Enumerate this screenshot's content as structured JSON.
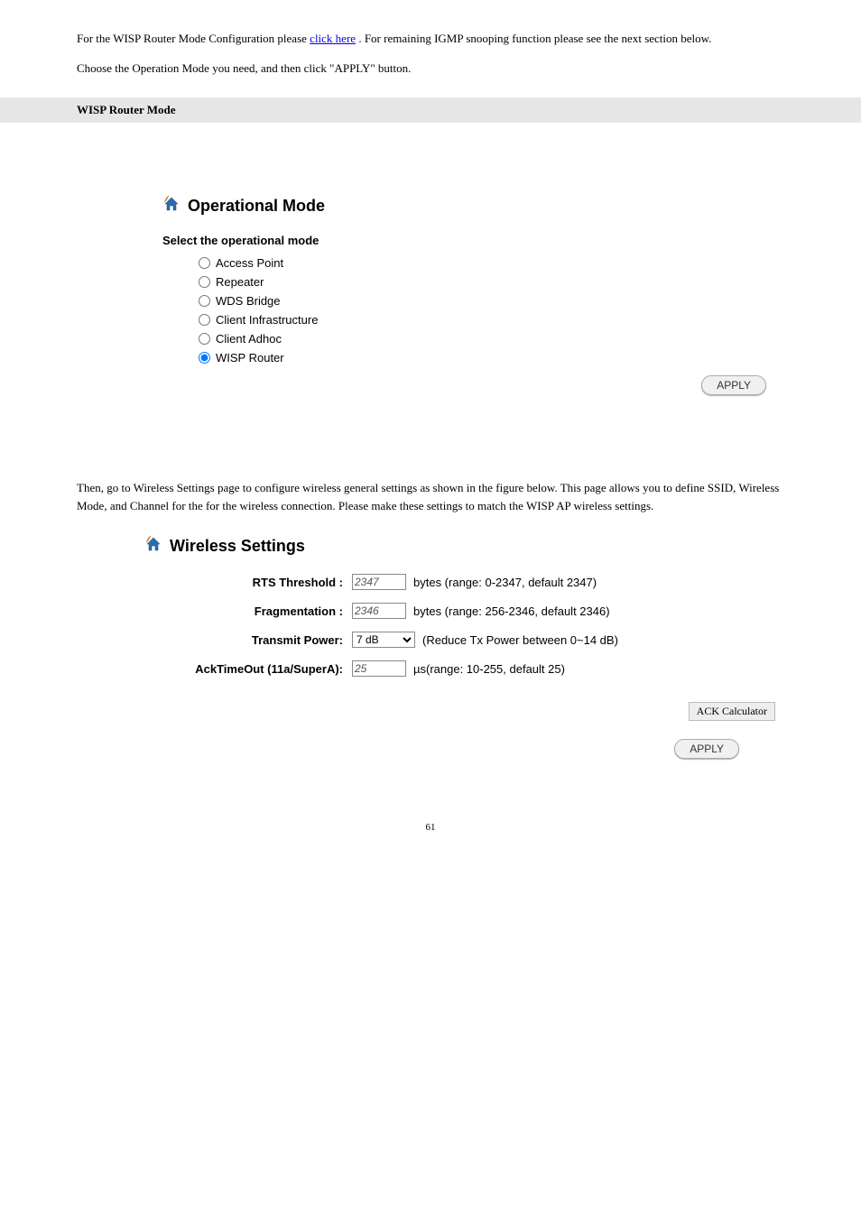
{
  "intro_text": {
    "para1_prefix": "For the WISP Router Mode Configuration please ",
    "para1_link": "click here",
    "para1_suffix": ". For remaining IGMP snooping function please see the next section below.",
    "para2": "Choose the Operation Mode you need, and then click \"APPLY\" button."
  },
  "section_heading": "WISP Router Mode",
  "operational_mode": {
    "title": "Operational Mode",
    "subtitle": "Select the operational mode",
    "options": [
      {
        "label": "Access Point",
        "selected": false
      },
      {
        "label": "Repeater",
        "selected": false
      },
      {
        "label": "WDS Bridge",
        "selected": false
      },
      {
        "label": "Client Infrastructure",
        "selected": false
      },
      {
        "label": "Client Adhoc",
        "selected": false
      },
      {
        "label": "WISP Router",
        "selected": true
      }
    ],
    "apply_label": "APPLY"
  },
  "wireless_body_text": {
    "para1": "Then, go to Wireless Settings page to configure wireless general settings as shown in the figure below. This page allows you to define SSID, Wireless Mode, and Channel for the for the wireless connection. Please make these settings to match the WISP AP wireless settings."
  },
  "wireless_settings": {
    "title": "Wireless Settings",
    "rts": {
      "label": "RTS Threshold :",
      "value": "2347",
      "hint": "bytes (range: 0-2347, default 2347)"
    },
    "frag": {
      "label": "Fragmentation :",
      "value": "2346",
      "hint": "bytes (range: 256-2346, default 2346)"
    },
    "tx": {
      "label": "Transmit Power:",
      "value": "7 dB",
      "hint": "(Reduce Tx Power between 0~14 dB)"
    },
    "ack": {
      "label": "AckTimeOut (11a/SuperA):",
      "value": "25",
      "hint": "µs(range: 10-255, default 25)"
    },
    "ack_calc_label": "ACK Calculator",
    "apply_label": "APPLY"
  },
  "page_number": "61"
}
